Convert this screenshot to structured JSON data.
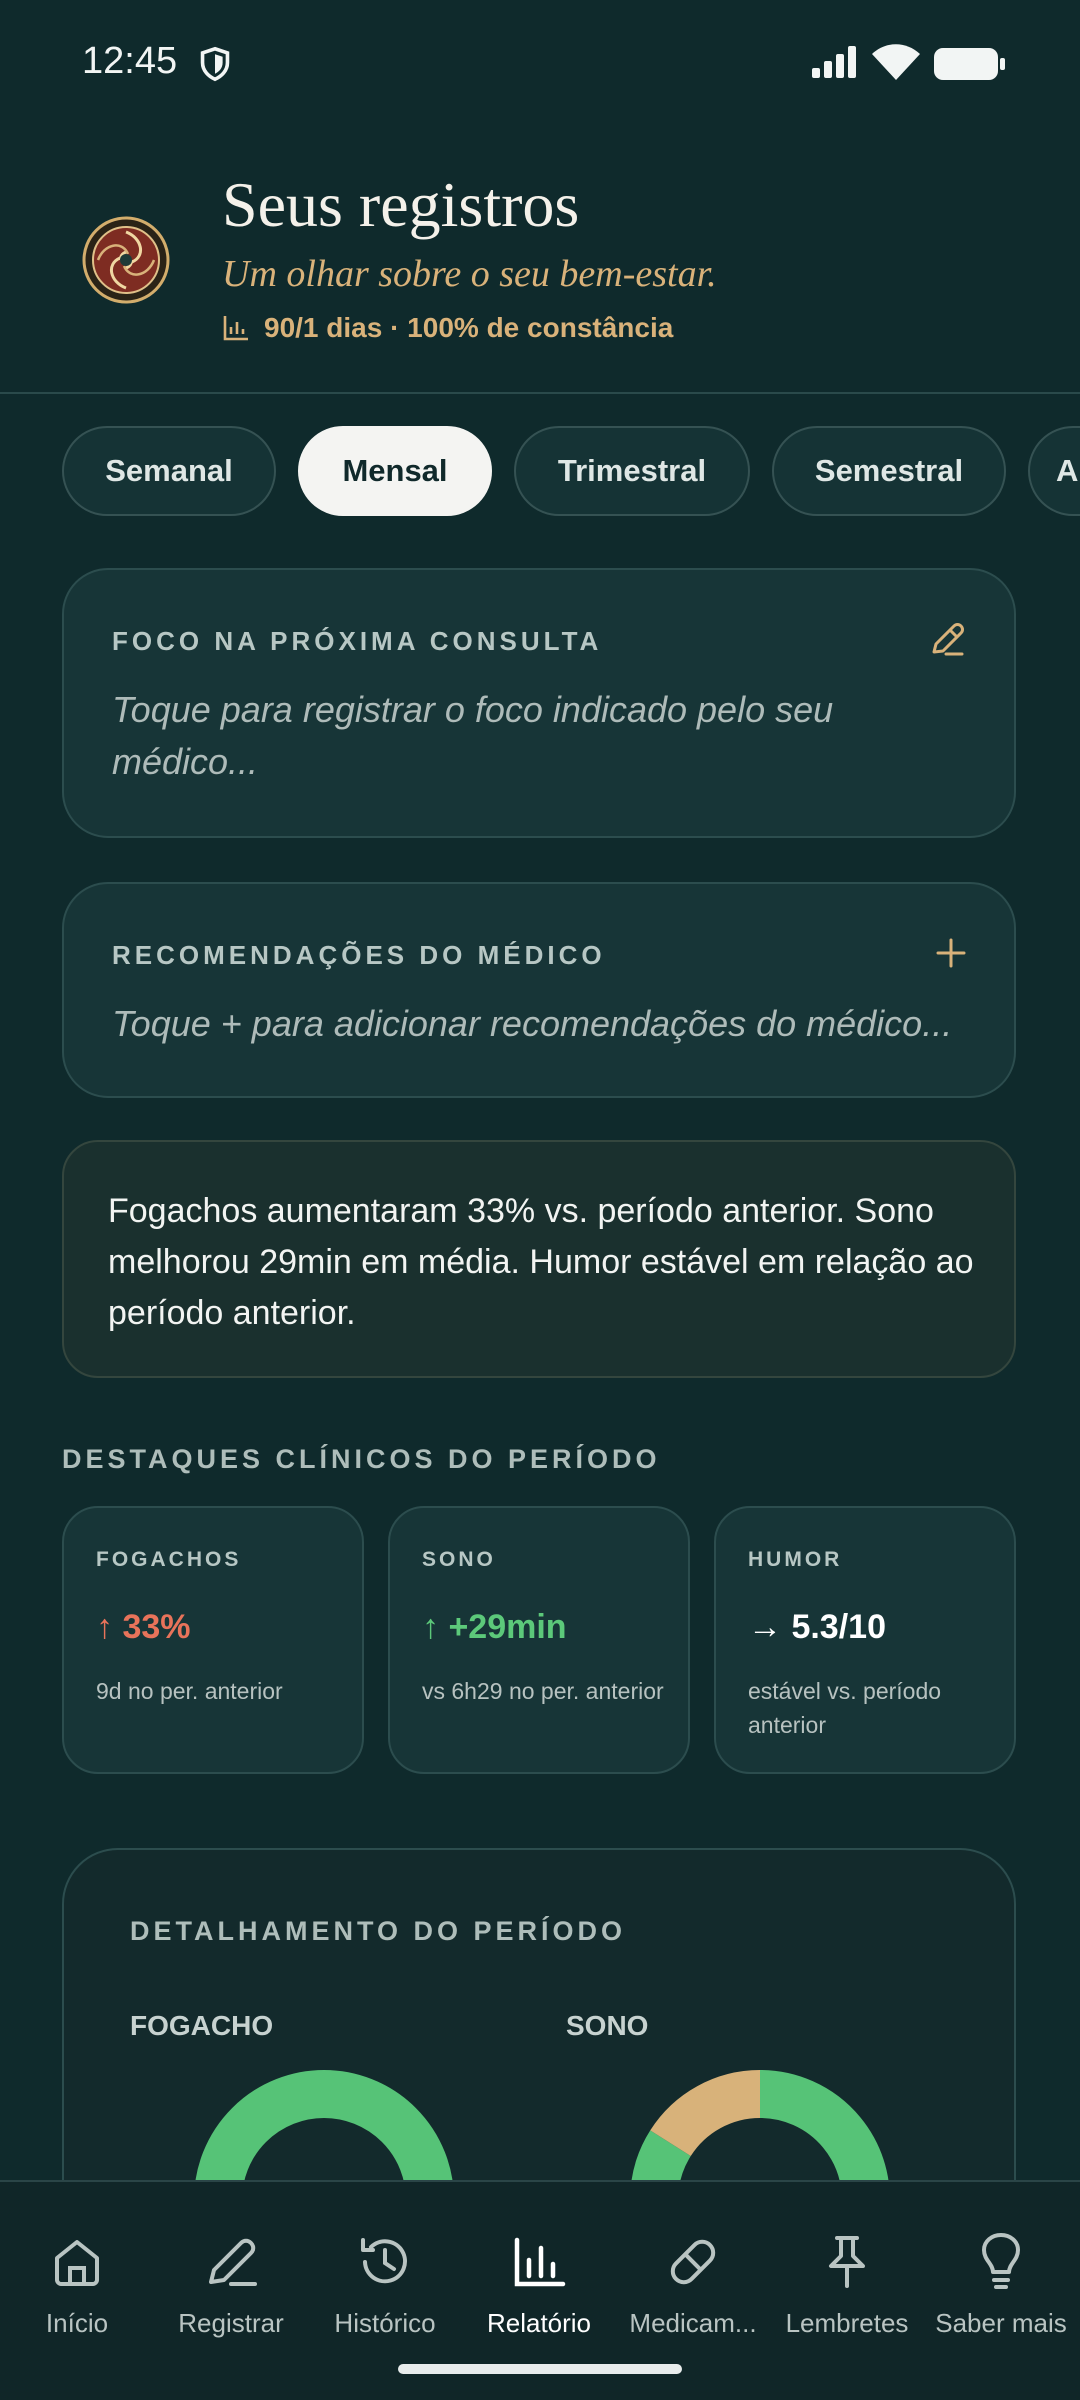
{
  "status_bar": {
    "time": "12:45"
  },
  "header": {
    "title": "Seus registros",
    "subtitle": "Um olhar sobre o seu bem-estar.",
    "stats": "90/1 dias · 100% de constância"
  },
  "tabs": [
    "Semanal",
    "Mensal",
    "Trimestral",
    "Semestral",
    "A"
  ],
  "active_tab": "Mensal",
  "focus_card": {
    "label": "FOCO NA PRÓXIMA CONSULTA",
    "hint": "Toque para registrar o foco indicado pelo seu médico..."
  },
  "recommendations_card": {
    "label": "RECOMENDAÇÕES DO MÉDICO",
    "hint": "Toque + para adicionar recomendações do médico..."
  },
  "summary": "Fogachos aumentaram 33% vs. período anterior. Sono melhorou 29min em média. Humor estável em relação ao período anterior.",
  "highlights": {
    "title": "DESTAQUES CLÍNICOS DO PERÍODO",
    "items": [
      {
        "label": "FOGACHOS",
        "arrow": "↑",
        "value": "33%",
        "sub": "9d no per. anterior",
        "color": "#e8735a"
      },
      {
        "label": "SONO",
        "arrow": "↑",
        "value": "+29min",
        "sub": "vs 6h29 no per. anterior",
        "color": "#5cc97a"
      },
      {
        "label": "HUMOR",
        "arrow": "→",
        "value": "5.3/10",
        "sub": "estável vs. período anterior",
        "color": "#ffffff"
      }
    ]
  },
  "detail": {
    "title": "DETALHAMENTO DO PERÍODO",
    "charts": [
      {
        "label": "FOGACHO",
        "segments": [
          {
            "fraction": 1.0,
            "color": "#56c377"
          }
        ]
      },
      {
        "label": "SONO",
        "segments": [
          {
            "fraction": 0.84,
            "color": "#56c377"
          },
          {
            "fraction": 0.16,
            "color": "#d8b27a"
          }
        ]
      }
    ]
  },
  "nav": [
    {
      "label": "Início",
      "icon": "home-icon"
    },
    {
      "label": "Registrar",
      "icon": "pencil-icon"
    },
    {
      "label": "Histórico",
      "icon": "history-icon"
    },
    {
      "label": "Relatório",
      "icon": "bar-chart-icon"
    },
    {
      "label": "Medicam...",
      "icon": "pill-icon"
    },
    {
      "label": "Lembretes",
      "icon": "pin-icon"
    },
    {
      "label": "Saber mais",
      "icon": "lightbulb-icon"
    }
  ],
  "active_nav": "Relatório",
  "colors": {
    "background": "#0f2a2c",
    "gold": "#d9b27a",
    "green": "#56c377"
  }
}
